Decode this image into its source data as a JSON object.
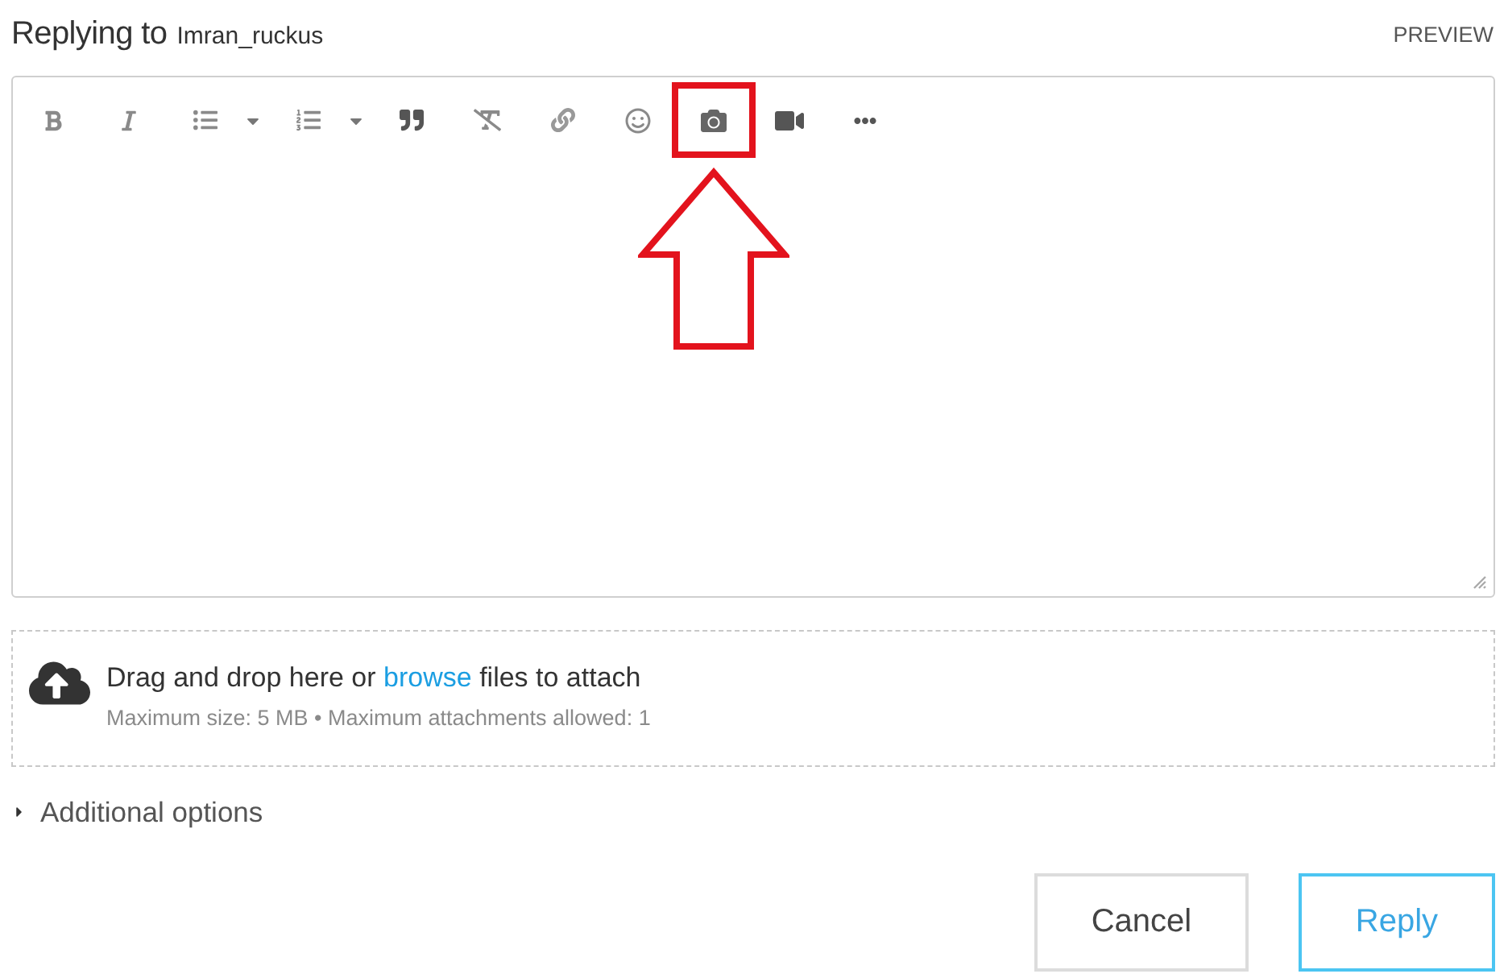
{
  "header": {
    "title": "Replying to",
    "username": "Imran_ruckus",
    "preview": "PREVIEW"
  },
  "editor": {
    "toolbar": [
      {
        "kind": "bold",
        "highlighted": false
      },
      {
        "kind": "italic",
        "highlighted": false
      },
      {
        "kind": "bullet-list",
        "highlighted": false
      },
      {
        "kind": "dropdown",
        "highlighted": false
      },
      {
        "kind": "numbered-list",
        "highlighted": false
      },
      {
        "kind": "dropdown",
        "highlighted": false
      },
      {
        "kind": "quote",
        "highlighted": false
      },
      {
        "kind": "clear-format",
        "highlighted": false
      },
      {
        "kind": "link",
        "highlighted": false
      },
      {
        "kind": "emoji",
        "highlighted": false
      },
      {
        "kind": "camera",
        "highlighted": true
      },
      {
        "kind": "video",
        "highlighted": false
      },
      {
        "kind": "more",
        "highlighted": false
      }
    ]
  },
  "upload": {
    "before": "Drag and drop here or",
    "link": "browse",
    "after": "files to attach",
    "note": "Maximum size: 5 MB • Maximum attachments allowed: 1"
  },
  "additional_options": {
    "label": "Additional options",
    "expanded": false
  },
  "buttons": [
    {
      "label": "Cancel",
      "kind": "secondary"
    },
    {
      "label": "Reply",
      "kind": "primary"
    }
  ]
}
